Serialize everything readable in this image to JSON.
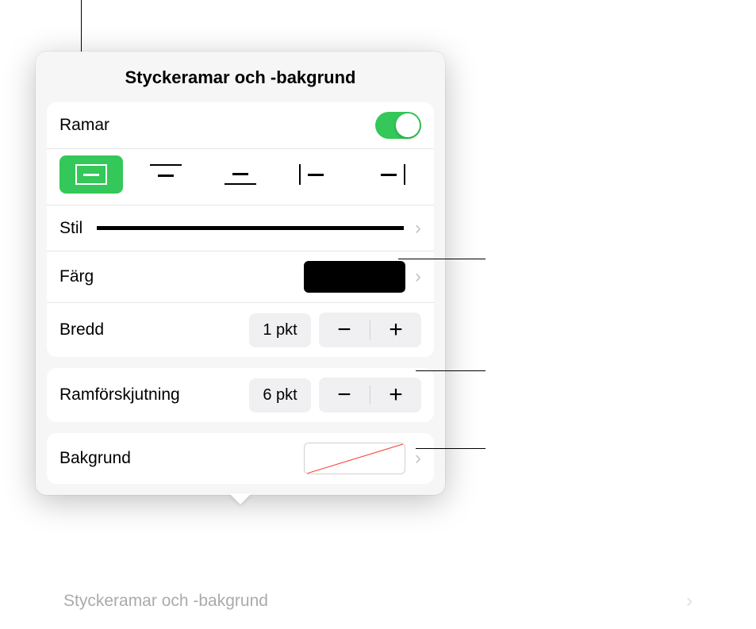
{
  "popover": {
    "title": "Styckeramar och -bakgrund",
    "ramar": {
      "label": "Ramar",
      "on": true
    },
    "borderPositions": [
      "all",
      "top",
      "bottom",
      "left",
      "right"
    ],
    "activeBorder": "all",
    "stil": {
      "label": "Stil"
    },
    "farg": {
      "label": "Färg",
      "value": "#000000"
    },
    "bredd": {
      "label": "Bredd",
      "value": "1 pkt"
    },
    "ramforskjutning": {
      "label": "Ramförskjutning",
      "value": "6 pkt"
    },
    "bakgrund": {
      "label": "Bakgrund"
    },
    "underlying": {
      "label": "Styckeramar och -bakgrund"
    }
  }
}
